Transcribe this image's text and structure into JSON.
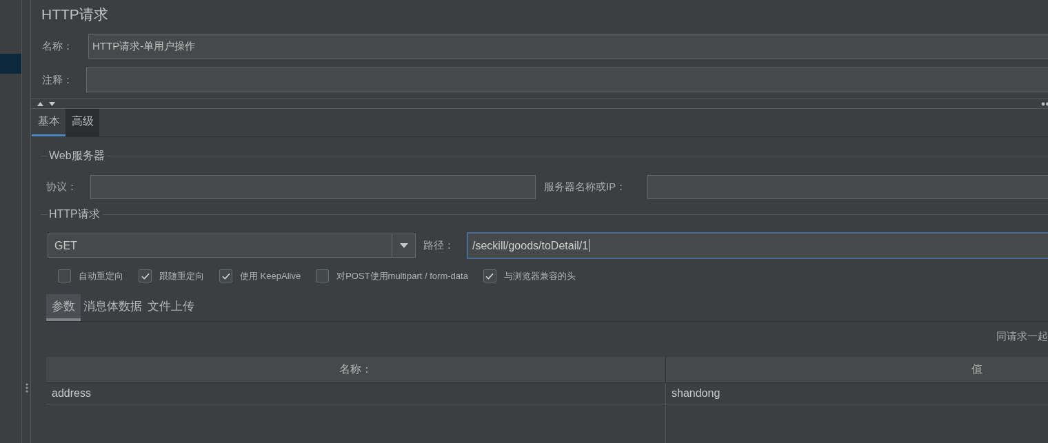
{
  "title": "HTTP请求",
  "tree": {
    "rows": [
      {
        "selected": true
      }
    ]
  },
  "name_field": {
    "label": "名称：",
    "value": "HTTP请求-单用户操作"
  },
  "comment_field": {
    "label": "注释："
  },
  "tabs": [
    {
      "label": "基本",
      "selected": true
    },
    {
      "label": "高级",
      "selected": false
    }
  ],
  "web_server": {
    "title": "Web服务器",
    "protocol": {
      "label": "协议："
    },
    "server": {
      "label": "服务器名称或IP："
    }
  },
  "http_request": {
    "title": "HTTP请求",
    "method": "GET",
    "path": {
      "label": "路径：",
      "value": "/seckill/goods/toDetail/1",
      "focused": true
    }
  },
  "options": [
    {
      "label": "自动重定向",
      "checked": false
    },
    {
      "label": "跟随重定向",
      "checked": true
    },
    {
      "label": "使用 KeepAlive",
      "checked": true
    },
    {
      "label": "对POST使用multipart / form-data",
      "checked": false
    },
    {
      "label": "与浏览器兼容的头",
      "checked": true
    }
  ],
  "sub_tabs": [
    {
      "label": "参数",
      "selected": true
    },
    {
      "label": "消息体数据",
      "selected": false
    },
    {
      "label": "文件上传",
      "selected": false
    }
  ],
  "params_table": {
    "caption": "同请求一起",
    "columns": [
      "名称：",
      "值"
    ],
    "rows": [
      [
        "address",
        "shandong"
      ]
    ]
  }
}
